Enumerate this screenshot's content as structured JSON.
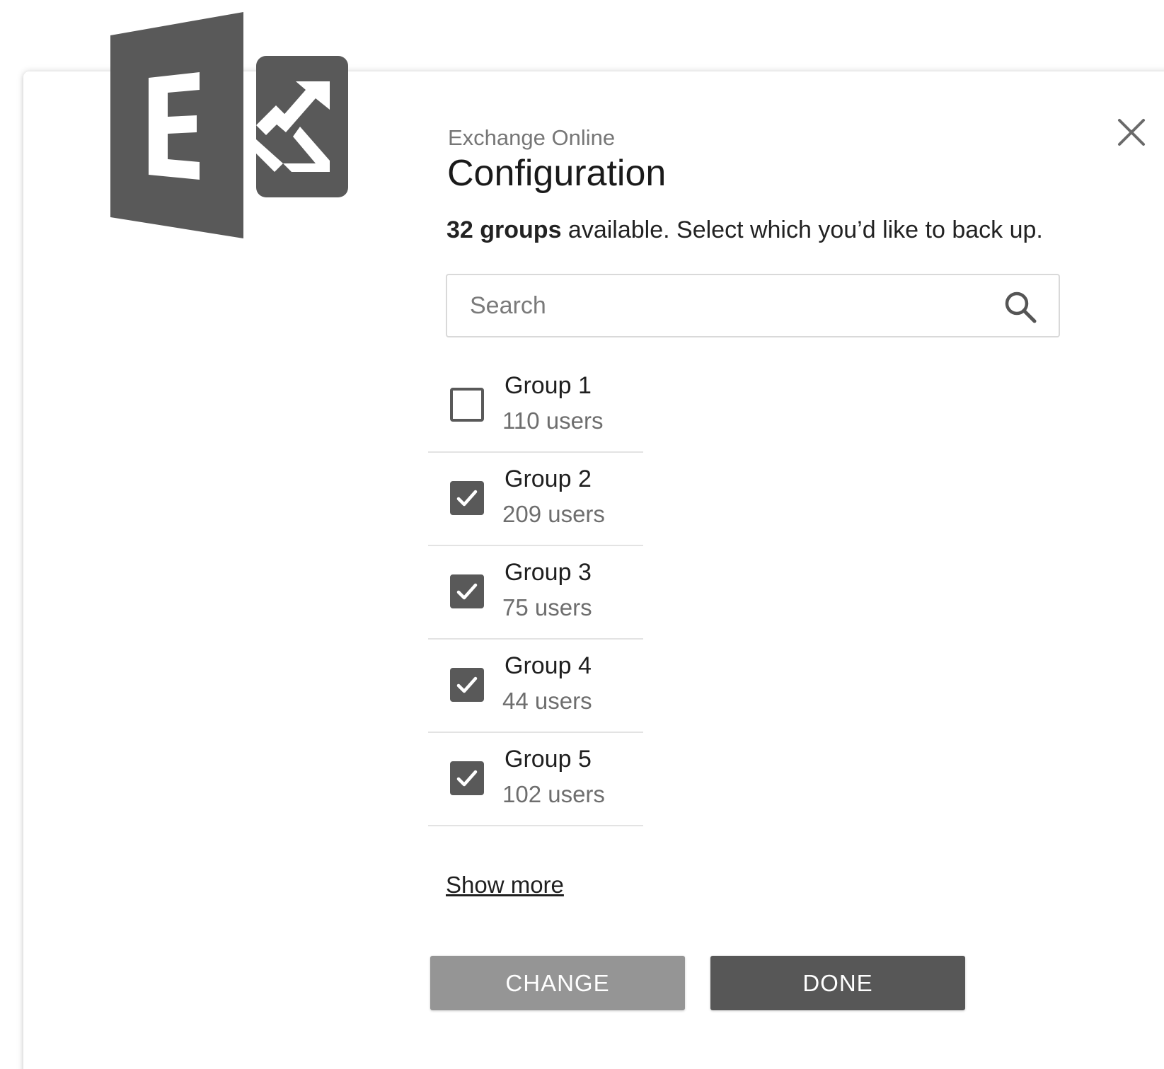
{
  "colors": {
    "logo": "#595959",
    "checkbox_checked": "#595959",
    "secondary_button": "#959595",
    "primary_button": "#575757",
    "muted_text": "#767676"
  },
  "header": {
    "eyebrow": "Exchange Online",
    "title": "Configuration",
    "close_icon": "close-icon",
    "logo_icon": "exchange-logo-icon"
  },
  "summary": {
    "count_bold": "32 groups",
    "rest": " available. Select which you’d like to back up."
  },
  "search": {
    "placeholder": "Search",
    "value": "",
    "icon": "search-icon"
  },
  "groups": [
    {
      "name": "Group 1",
      "users": "110 users",
      "checked": false
    },
    {
      "name": "Group 2",
      "users": "209 users",
      "checked": true
    },
    {
      "name": "Group 3",
      "users": "75 users",
      "checked": true
    },
    {
      "name": "Group 4",
      "users": "44 users",
      "checked": true
    },
    {
      "name": "Group 5",
      "users": "102 users",
      "checked": true
    }
  ],
  "show_more_label": "Show more",
  "actions": {
    "change_label": "CHANGE",
    "done_label": "DONE"
  }
}
